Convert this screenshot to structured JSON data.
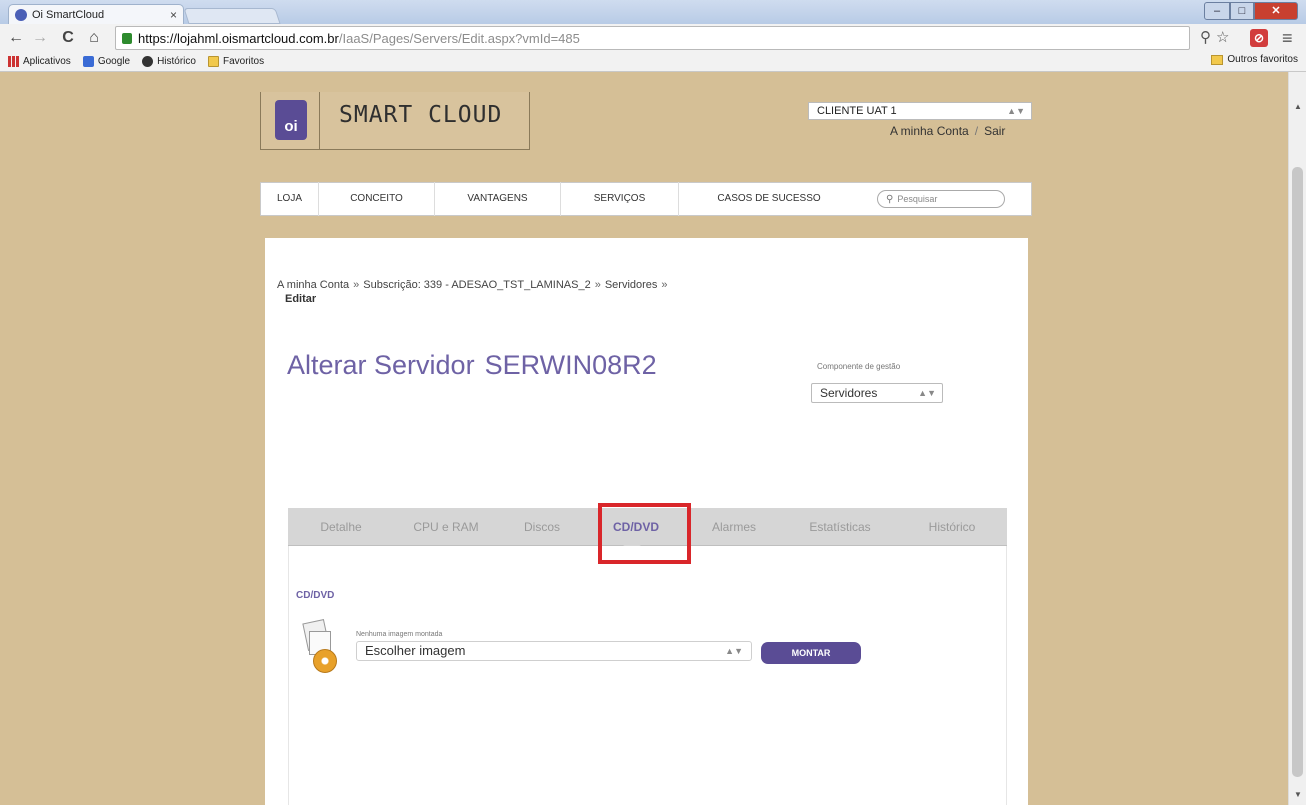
{
  "browser": {
    "tab_title": "Oi SmartCloud",
    "tab_close": "×",
    "window_controls": {
      "minimize": "–",
      "maximize": "□",
      "close": "✕"
    },
    "nav": {
      "back": "←",
      "forward": "→",
      "reload": "C",
      "home": "⌂"
    },
    "url_host": "https://lojahml.oismartcloud.com.br",
    "url_path": "/IaaS/Pages/Servers/Edit.aspx?vmId=485",
    "right_icons": {
      "zoom": "⚲",
      "star": "☆",
      "extension": "⊘",
      "menu": "≡"
    },
    "bookmarks": [
      {
        "label": "Aplicativos",
        "icon": "apps-icon"
      },
      {
        "label": "Google",
        "icon": "google-icon"
      },
      {
        "label": "Histórico",
        "icon": "history-icon"
      },
      {
        "label": "Favoritos",
        "icon": "folder-icon"
      }
    ],
    "other_bookmarks": "Outros favoritos"
  },
  "header": {
    "logo_badge": "oi",
    "logo_text": "SMART CLOUD",
    "client_select": "CLIENTE UAT 1",
    "my_account": "A minha Conta",
    "account_separator": "/",
    "logout": "Sair"
  },
  "main_nav": {
    "items": [
      "LOJA",
      "CONCEITO",
      "VANTAGENS",
      "SERVIÇOS",
      "CASOS DE SUCESSO"
    ],
    "search_placeholder": "Pesquisar"
  },
  "breadcrumb": {
    "items": [
      "A minha Conta",
      "Subscrição: 339 - ADESAO_TST_LAMINAS_2",
      "Servidores"
    ],
    "separator": "»",
    "current": "Editar"
  },
  "page": {
    "title": "Alterar Servidor",
    "server_name": "SERWIN08R2",
    "component_label": "Componente de gestão",
    "component_value": "Servidores"
  },
  "tabs": {
    "items": [
      "Detalhe",
      "CPU e RAM",
      "Discos",
      "CD/DVD",
      "Alarmes",
      "Estatísticas",
      "Histórico"
    ],
    "active": "CD/DVD"
  },
  "cd_dvd": {
    "heading": "CD/DVD",
    "image_label": "Nenhuma imagem montada",
    "image_select": "Escolher imagem",
    "mount_button": "MONTAR"
  },
  "colors": {
    "brand_purple": "#5a4c95",
    "title_purple": "#6e62a5",
    "page_background": "#d5bf96",
    "highlight_red": "#d9262a"
  }
}
